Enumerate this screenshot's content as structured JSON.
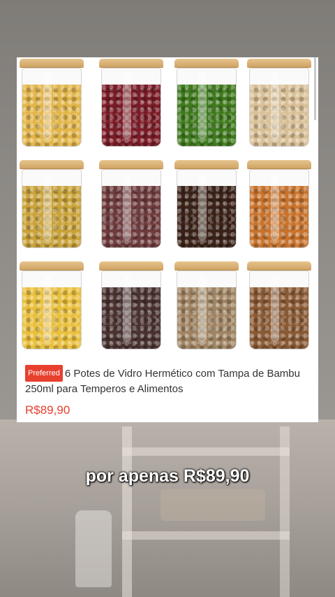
{
  "product": {
    "badge": "Preferred",
    "title": "6 Potes de Vidro Hermético com Tampa de Bambu 250ml para Temperos e Alimentos",
    "price": "R$89,90"
  },
  "caption": "por apenas R$89,90",
  "jars": [
    {
      "name": "jar-dried-flowers",
      "color": "#e2b54a"
    },
    {
      "name": "jar-red-beans",
      "color": "#7a1c27"
    },
    {
      "name": "jar-mung-beans",
      "color": "#3f7a1e"
    },
    {
      "name": "jar-pistachios",
      "color": "#d8bf95"
    },
    {
      "name": "jar-chrysanthemum",
      "color": "#c9a23a"
    },
    {
      "name": "jar-speckled-beans",
      "color": "#6e3b3d"
    },
    {
      "name": "jar-coffee-beans",
      "color": "#3b2218"
    },
    {
      "name": "jar-dried-orange",
      "color": "#c8732d"
    },
    {
      "name": "jar-millet",
      "color": "#e9bf3c"
    },
    {
      "name": "jar-mixed-seeds",
      "color": "#4a3230"
    },
    {
      "name": "jar-oats",
      "color": "#a08462"
    },
    {
      "name": "jar-mixed-nuts",
      "color": "#8a5a34"
    }
  ]
}
